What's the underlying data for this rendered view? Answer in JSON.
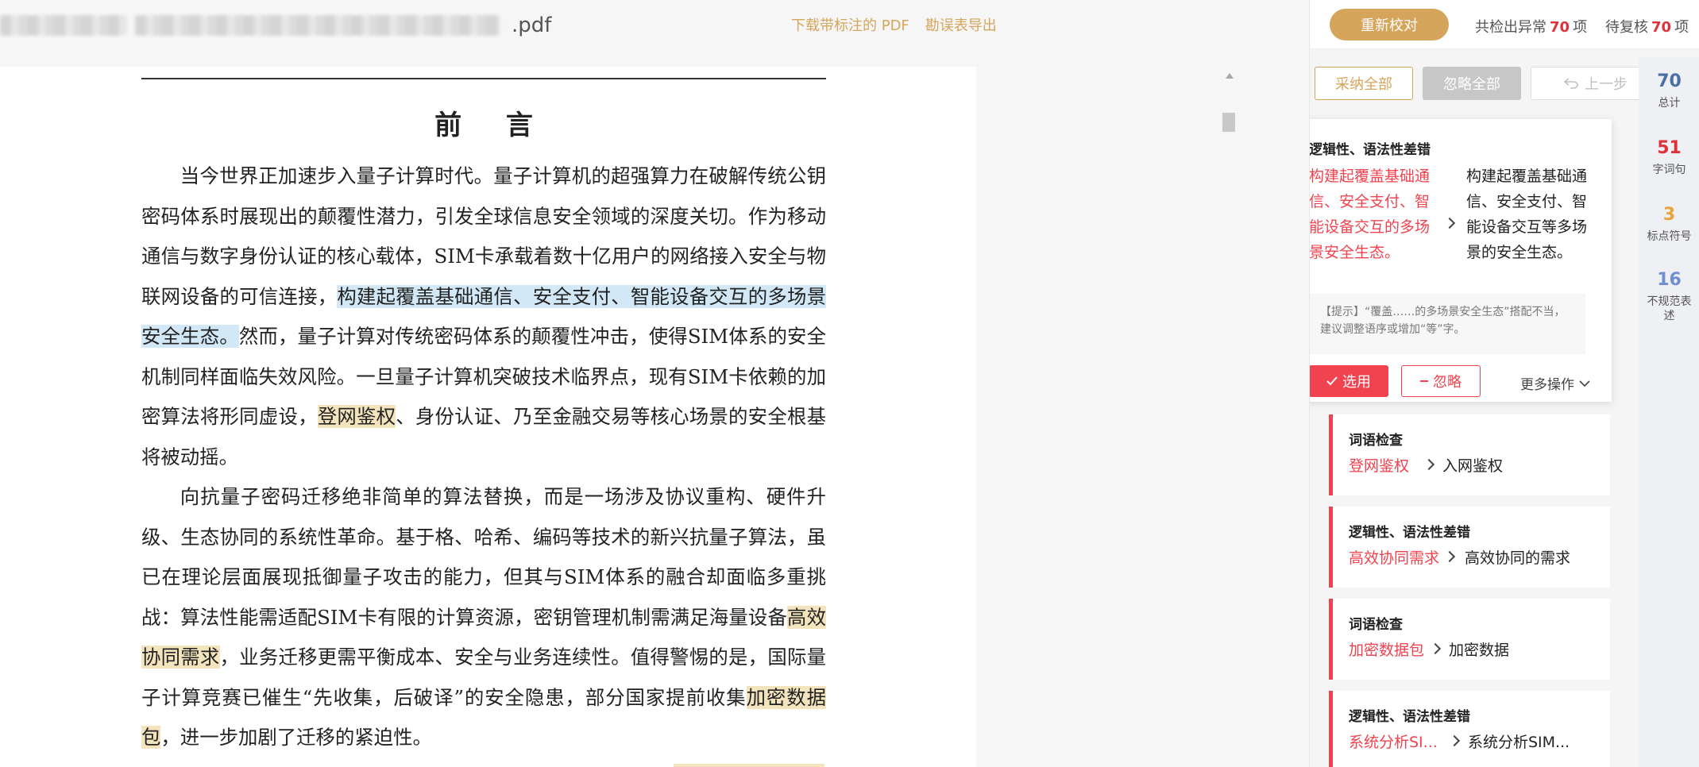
{
  "file": {
    "extension": ".pdf"
  },
  "top_links": {
    "download": "下载带标注的 PDF",
    "export": "勘误表导出"
  },
  "document": {
    "heading": "前  言",
    "p1_a": "当今世界正加速步入量子计算时代。量子计算机的超强算力在破解传统公钥密码体系时展现出的颠覆性潜力，引发全球信息安全领域的深度关切。作为移动通信与数字身份认证的核心载体，SIM卡承载着数十亿用户的网络接入安全与物联网设备的可信连接，",
    "p1_hl": "构建起覆盖基础通信、安全支付、智能设备交互的多场景安全生态。",
    "p1_b": "然而，量子计算对传统密码体系的颠覆性冲击，使得SIM体系的安全机制同样面临失效风险。一旦量子计算机突破技术临界点，现有SIM卡依赖的加密算法将形同虚设，",
    "p1_hl2": "登网鉴权",
    "p1_c": "、身份认证、乃至金融交易等核心场景的安全根基将被动摇。",
    "p2_a": "向抗量子密码迁移绝非简单的算法替换，而是一场涉及协议重构、硬件升级、生态协同的系统性革命。基于格、哈希、编码等技术的新兴抗量子算法，虽已在理论层面展现抵御量子攻击的能力，但其与SIM体系的融合却面临多重挑战：算法性能需适配SIM卡有限的计算资源，密钥管理机制需满足海量设备",
    "p2_hl": "高效协同需求",
    "p2_b": "，业务迁移更需平衡成本、安全与业务连续性。值得警惕的是，国际量子计算竞赛已催生“先收集，后破译”的安全隐患，部分国家提前收集",
    "p2_hl2": "加密数据包",
    "p2_c": "，进一步加剧了迁移的紧迫性。"
  },
  "panel": {
    "recheck": "重新校对",
    "stat_found_prefix": "共检出异常",
    "stat_found_count": "70",
    "stat_found_suffix": "项",
    "stat_pending_prefix": "待复核",
    "stat_pending_count": "70",
    "stat_pending_suffix": "项",
    "adopt_all": "采纳全部",
    "ignore_all": "忽略全部",
    "undo": "上一步",
    "active_card": {
      "title": "逻辑性、语法性差错",
      "original": "构建起覆盖基础通信、安全支付、智能设备交互的多场景安全生态。",
      "suggestion": "构建起覆盖基础通信、安全支付、智能设备交互等多场景的安全生态。",
      "tip": "【提示】“覆盖……的多场景安全生态”搭配不当，建议调整语序或增加“等”字。",
      "use": "选用",
      "ignore": "忽略",
      "more": "更多操作"
    },
    "cards": [
      {
        "title": "词语检查",
        "original": "登网鉴权",
        "suggestion": "入网鉴权"
      },
      {
        "title": "逻辑性、语法性差错",
        "original": "高效协同需求",
        "suggestion": "高效协同的需求"
      },
      {
        "title": "词语检查",
        "original": "加密数据包",
        "suggestion": "加密数据"
      },
      {
        "title": "逻辑性、语法性差错",
        "original": "系统分析SI...",
        "suggestion": "系统分析SIM..."
      }
    ],
    "rail": [
      {
        "count": "70",
        "label": "总计",
        "color": "#4a6fa5"
      },
      {
        "count": "51",
        "label": "字词句",
        "color": "#e0303a"
      },
      {
        "count": "3",
        "label": "标点符号",
        "color": "#e8a33a"
      },
      {
        "count": "16",
        "label": "不规范表述",
        "color": "#6f8fd0"
      }
    ]
  }
}
